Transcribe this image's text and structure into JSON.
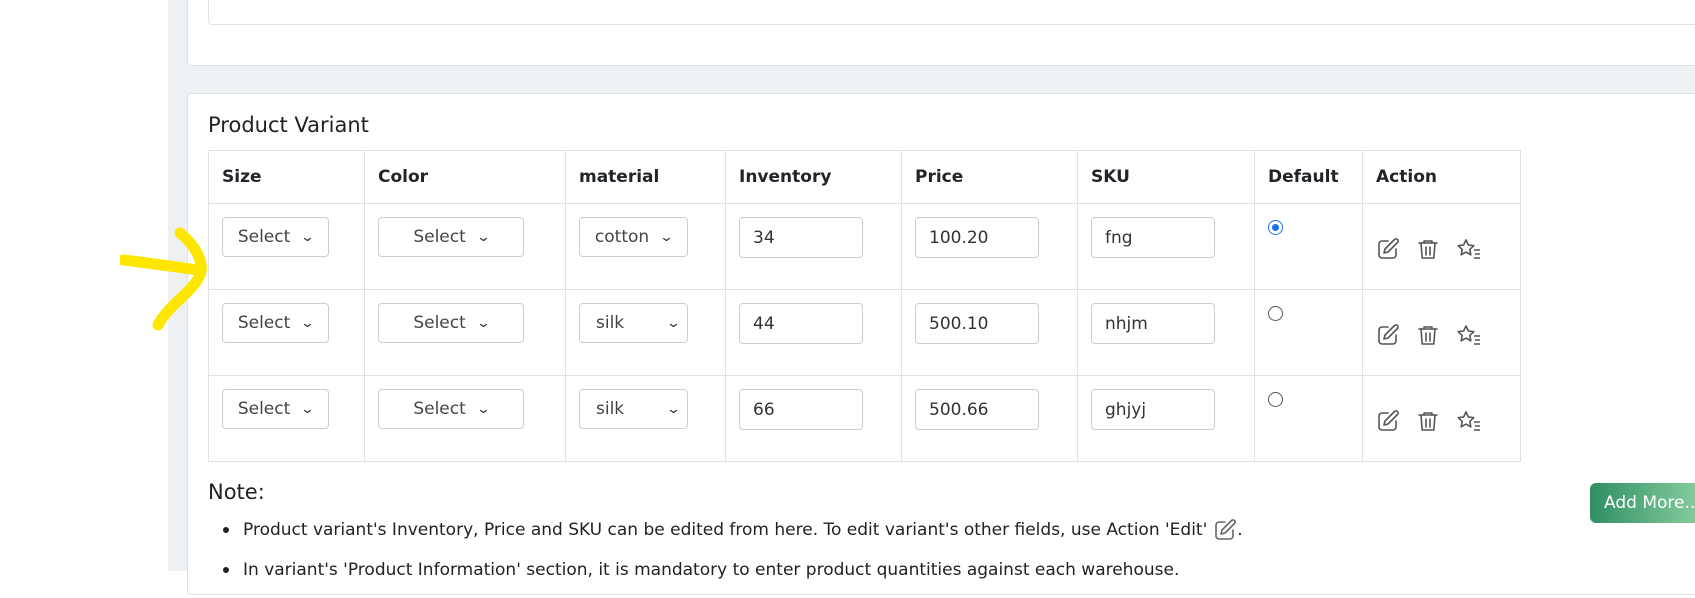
{
  "section": {
    "title": "Product Variant"
  },
  "table": {
    "headers": [
      "Size",
      "Color",
      "material",
      "Inventory",
      "Price",
      "SKU",
      "Default",
      "Action"
    ],
    "rows": [
      {
        "size": "Select",
        "color": "Select",
        "material": "cotton",
        "inventory": "34",
        "price": "100.20",
        "sku": "fng",
        "default": true
      },
      {
        "size": "Select",
        "color": "Select",
        "material": "silk",
        "inventory": "44",
        "price": "500.10",
        "sku": "nhjm",
        "default": false
      },
      {
        "size": "Select",
        "color": "Select",
        "material": "silk",
        "inventory": "66",
        "price": "500.66",
        "sku": "ghjyj",
        "default": false
      }
    ]
  },
  "note": {
    "title": "Note:",
    "items": [
      "Product variant's Inventory, Price and SKU can be edited from here. To edit variant's other fields, use Action 'Edit'",
      "In variant's 'Product Information' section, it is mandatory to enter product quantities against each warehouse."
    ],
    "item0_suffix": "."
  },
  "buttons": {
    "add_more": "Add More..."
  },
  "colors": {
    "accent": "#1a73e8",
    "add_more_start": "#2f8f63",
    "highlight": "#ffe600"
  },
  "icons": [
    "edit-icon",
    "trash-icon",
    "star-list-icon",
    "chevron-down-icon"
  ]
}
